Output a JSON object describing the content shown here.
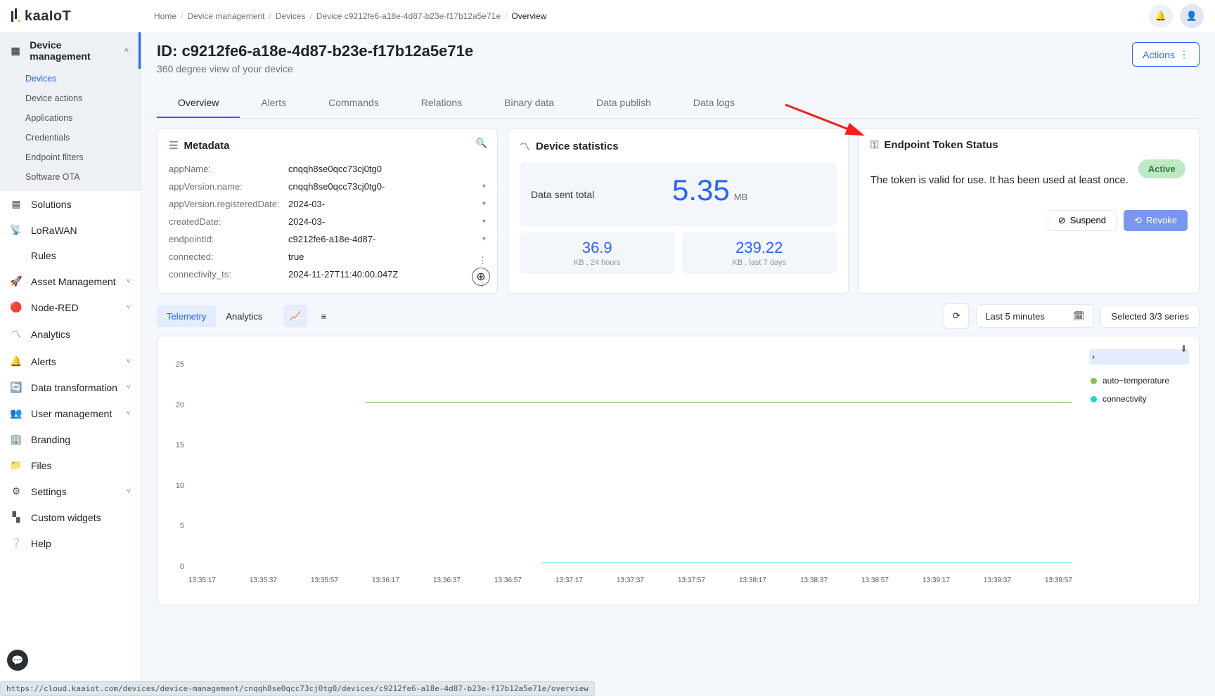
{
  "brand": "kaaIoT",
  "breadcrumbs": [
    "Home",
    "Device management",
    "Devices",
    "Device c9212fe6-a18e-4d87-b23e-f17b12a5e71e",
    "Overview"
  ],
  "page": {
    "title": "ID: c9212fe6-a18e-4d87-b23e-f17b12a5e71e",
    "subtitle": "360 degree view of your device",
    "actions_label": "Actions"
  },
  "sidebar": {
    "main": {
      "label": "Device management",
      "expanded": true,
      "items": [
        "Devices",
        "Device actions",
        "Applications",
        "Credentials",
        "Endpoint filters",
        "Software OTA"
      ],
      "active": 0
    },
    "others": [
      {
        "label": "Solutions",
        "icon": "grid"
      },
      {
        "label": "LoRaWAN",
        "icon": "antenna"
      },
      {
        "label": "Rules",
        "icon": "code"
      },
      {
        "label": "Asset Management",
        "icon": "rocket",
        "chev": true
      },
      {
        "label": "Node-RED",
        "icon": "nodered",
        "chev": true
      },
      {
        "label": "Analytics",
        "icon": "trend"
      },
      {
        "label": "Alerts",
        "icon": "bell",
        "chev": true
      },
      {
        "label": "Data transformation",
        "icon": "transform",
        "chev": true
      },
      {
        "label": "User management",
        "icon": "users",
        "chev": true
      },
      {
        "label": "Branding",
        "icon": "building"
      },
      {
        "label": "Files",
        "icon": "folder"
      },
      {
        "label": "Settings",
        "icon": "gear",
        "chev": true
      },
      {
        "label": "Custom widgets",
        "icon": "widgets"
      },
      {
        "label": "Help",
        "icon": "help"
      }
    ]
  },
  "tabs": [
    "Overview",
    "Alerts",
    "Commands",
    "Relations",
    "Binary data",
    "Data publish",
    "Data logs"
  ],
  "tabs_active": 0,
  "metadata": {
    "title": "Metadata",
    "rows": [
      {
        "k": "appName:",
        "v": "cnqqh8se0qcc73cj0tg0"
      },
      {
        "k": "appVersion.name:",
        "v": "cnqqh8se0qcc73cj0tg0-",
        "exp": true
      },
      {
        "k": "appVersion.registeredDate:",
        "v": "2024-03-",
        "exp": true
      },
      {
        "k": "createdDate:",
        "v": "2024-03-",
        "exp": true
      },
      {
        "k": "endpointId:",
        "v": "c9212fe6-a18e-4d87-",
        "exp": true
      },
      {
        "k": "connected:",
        "v": "true"
      },
      {
        "k": "connectivity_ts:",
        "v": "2024-11-27T11:40:00.047Z"
      }
    ]
  },
  "stats": {
    "title": "Device statistics",
    "total_label": "Data sent total",
    "total_value": "5.35",
    "total_unit": "MB",
    "cells": [
      {
        "n": "36.9",
        "l": "KB , 24 hours"
      },
      {
        "n": "239.22",
        "l": "KB , last 7 days"
      }
    ]
  },
  "token": {
    "title": "Endpoint Token Status",
    "text": "The token is valid for use. It has been used at least once.",
    "badge": "Active",
    "suspend": "Suspend",
    "revoke": "Revoke"
  },
  "telemetry": {
    "tabs": [
      "Telemetry",
      "Analytics"
    ],
    "active": 0,
    "range": "Last 5 minutes",
    "series_label": "Selected 3/3 series",
    "legend": [
      {
        "name": "auto~temperature",
        "color": "#88c24a"
      },
      {
        "name": "connectivity",
        "color": "#20d0d6"
      }
    ]
  },
  "chart_data": {
    "type": "line",
    "xlabel": "",
    "ylabel": "",
    "ylim": [
      0,
      25
    ],
    "y_ticks": [
      25,
      20,
      15,
      10,
      5,
      0
    ],
    "x_ticks": [
      "13:35:17",
      "13:35:37",
      "13:35:57",
      "13:36:17",
      "13:36:37",
      "13:36:57",
      "13:37:17",
      "13:37:37",
      "13:37:57",
      "13:38:17",
      "13:38:37",
      "13:38:57",
      "13:39:17",
      "13:39:37",
      "13:39:57"
    ],
    "series": [
      {
        "name": "auto~temperature",
        "color": "#88c24a",
        "y_const": 20,
        "x_start": "13:36:17",
        "x_end": "13:39:57"
      },
      {
        "name": "connectivity",
        "color": "#20d0d6",
        "y_const": 1,
        "x_start": "13:36:57",
        "x_end": "13:39:57"
      }
    ]
  },
  "status_url": "https://cloud.kaaiot.com/devices/device-management/cnqqh8se0qcc73cj0tg0/devices/c9212fe6-a18e-4d87-b23e-f17b12a5e71e/overview"
}
